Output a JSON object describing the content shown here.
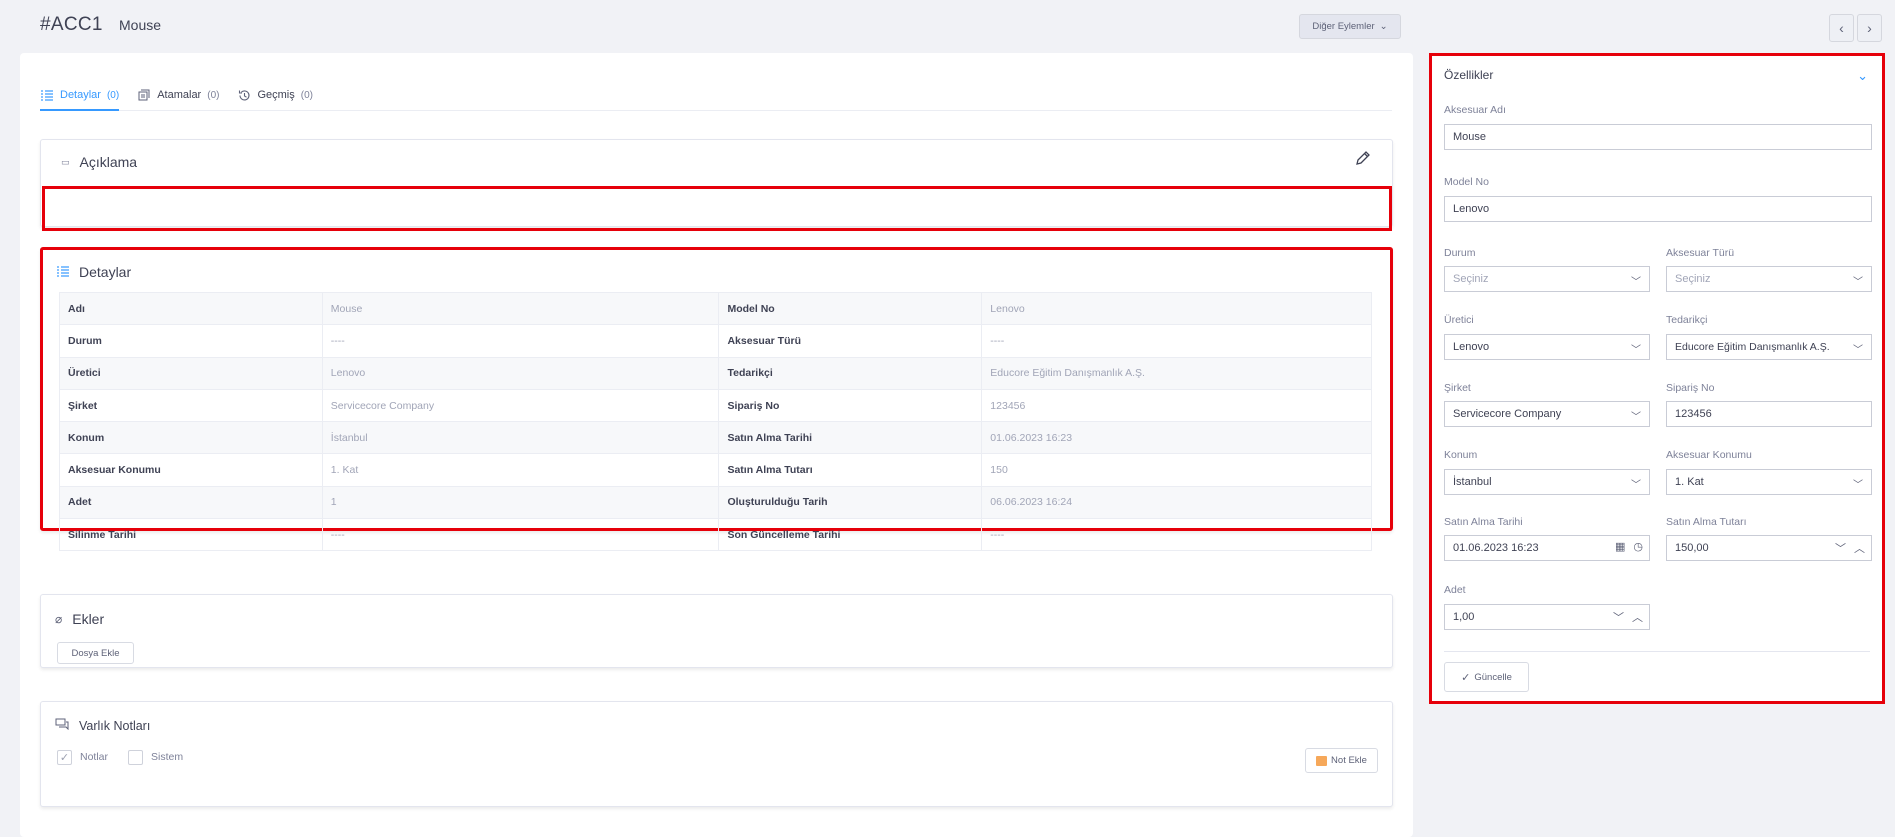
{
  "header": {
    "code": "#ACC1",
    "name": "Mouse",
    "other_actions": "Diğer Eylemler"
  },
  "tabs": [
    {
      "label": "Detaylar",
      "count": "(0)"
    },
    {
      "label": "Atamalar",
      "count": "(0)"
    },
    {
      "label": "Geçmiş",
      "count": "(0)"
    }
  ],
  "description": {
    "title": "Açıklama",
    "text": ""
  },
  "details": {
    "title": "Detaylar",
    "rows": [
      {
        "l1": "Adı",
        "v1": "Mouse",
        "l2": "Model No",
        "v2": "Lenovo"
      },
      {
        "l1": "Durum",
        "v1": "----",
        "l2": "Aksesuar Türü",
        "v2": "----"
      },
      {
        "l1": "Üretici",
        "v1": "Lenovo",
        "l2": "Tedarikçi",
        "v2": "Educore Eğitim Danışmanlık A.Ş."
      },
      {
        "l1": "Şirket",
        "v1": "Servicecore Company",
        "l2": "Sipariş No",
        "v2": "123456"
      },
      {
        "l1": "Konum",
        "v1": "İstanbul",
        "l2": "Satın Alma Tarihi",
        "v2": "01.06.2023 16:23"
      },
      {
        "l1": "Aksesuar Konumu",
        "v1": "1. Kat",
        "l2": "Satın Alma Tutarı",
        "v2": "150"
      },
      {
        "l1": "Adet",
        "v1": "1",
        "l2": "Oluşturulduğu Tarih",
        "v2": "06.06.2023 16:24"
      },
      {
        "l1": "Silinme Tarihi",
        "v1": "----",
        "l2": "Son Güncelleme Tarihi",
        "v2": "----"
      }
    ]
  },
  "attachments": {
    "title": "Ekler",
    "add_file": "Dosya Ekle"
  },
  "notes": {
    "title": "Varlık Notları",
    "filter_notes": "Notlar",
    "filter_system": "Sistem",
    "add_note": "Not Ekle"
  },
  "properties": {
    "title": "Özellikler",
    "accessory_name_label": "Aksesuar Adı",
    "accessory_name_value": "Mouse",
    "model_no_label": "Model No",
    "model_no_value": "Lenovo",
    "status_label": "Durum",
    "status_value": "Seçiniz",
    "accessory_type_label": "Aksesuar Türü",
    "accessory_type_value": "Seçiniz",
    "manufacturer_label": "Üretici",
    "manufacturer_value": "Lenovo",
    "supplier_label": "Tedarikçi",
    "supplier_value": "Educore Eğitim Danışmanlık A.Ş.",
    "company_label": "Şirket",
    "company_value": "Servicecore Company",
    "order_no_label": "Sipariş No",
    "order_no_value": "123456",
    "location_label": "Konum",
    "location_value": "İstanbul",
    "accessory_location_label": "Aksesuar Konumu",
    "accessory_location_value": "1. Kat",
    "purchase_date_label": "Satın Alma Tarihi",
    "purchase_date_value": "01.06.2023 16:23",
    "purchase_amount_label": "Satın Alma Tutarı",
    "purchase_amount_value": "150,00",
    "quantity_label": "Adet",
    "quantity_value": "1,00",
    "update_button": "Güncelle"
  }
}
